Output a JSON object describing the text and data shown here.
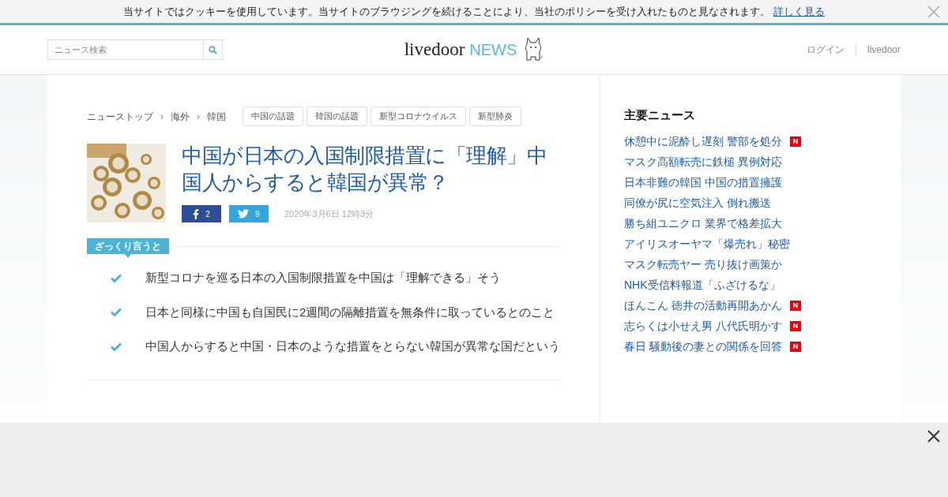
{
  "cookie_bar": {
    "message": "当サイトではクッキーを使用しています。当サイトのブラウジングを続けることにより、当社のポリシーを受け入れたものと見なされます。",
    "link": "詳しく見る"
  },
  "header": {
    "search": {
      "placeholder": "ニュース検索"
    },
    "logo": {
      "main": "livedoor",
      "suffix": "NEWS"
    },
    "nav": [
      "ログイン",
      "livedoor"
    ]
  },
  "breadcrumbs": [
    "ニューストップ",
    "海外",
    "韓国"
  ],
  "breadcrumb_separator": "›",
  "tags": [
    "中国の話題",
    "韓国の話題",
    "新型コロナウイルス",
    "新型肺炎"
  ],
  "article": {
    "title": "中国が日本の入国制限措置に「理解」中国人からすると韓国が異常？",
    "shares": [
      {
        "kind": "facebook",
        "count": "2"
      },
      {
        "kind": "twitter",
        "count": "9"
      }
    ],
    "date": "2020年3月6日 12時3分"
  },
  "summary": {
    "label": "ざっくり言うと",
    "points": [
      "新型コロナを巡る日本の入国制限措置を中国は「理解できる」そう",
      "日本と同様に中国も自国民に2週間の隔離措置を無条件に取っているとのこと",
      "中国人からすると中国・日本のような措置をとらない韓国が異常な国だという"
    ]
  },
  "sidebar": {
    "title": "主要ニュース",
    "items": [
      {
        "text": "休憩中に泥酔し遅刻 警部を処分",
        "badge": "N"
      },
      {
        "text": "マスク高額転売に鉄槌 異例対応"
      },
      {
        "text": "日本非難の韓国 中国の措置擁護"
      },
      {
        "text": "同僚が尻に空気注入 倒れ搬送"
      },
      {
        "text": "勝ち組ユニクロ 業界で格差拡大"
      },
      {
        "text": "アイリスオーヤマ「爆売れ」秘密"
      },
      {
        "text": "マスク転売ヤー 売り抜け画策か"
      },
      {
        "text": "NHK受信料報道「ふざけるな」"
      },
      {
        "text": "ほんこん 徳井の活動再開あかん",
        "badge": "N"
      },
      {
        "text": "志らくは小せえ男 八代氏明かす",
        "badge": "N"
      },
      {
        "text": "春日 騒動後の妻との関係を回答",
        "badge": "N"
      }
    ]
  }
}
